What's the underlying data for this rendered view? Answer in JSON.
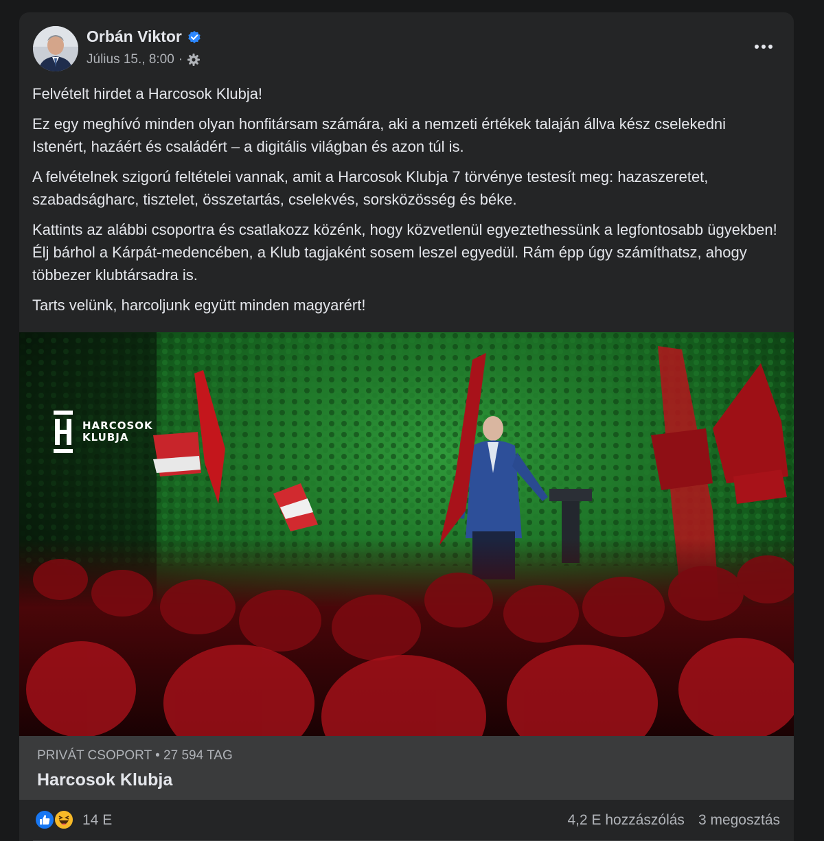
{
  "post": {
    "author": "Orbán Viktor",
    "timestamp": "Július 15., 8:00",
    "separator": "·",
    "paragraphs": [
      "Felvételt hirdet a Harcosok Klubja!",
      "Ez egy meghívó minden olyan honfitársam számára, aki a nemzeti értékek talaján állva kész cselekedni Istenért, hazáért és családért – a digitális világban és azon túl is.",
      "A felvételnek szigorú feltételei vannak, amit a Harcosok Klubja 7 törvénye testesít meg: hazaszeretet, szabadságharc, tisztelet, összetartás, cselekvés, sorsközösség és béke.",
      "Kattints az alábbi csoportra és csatlakozz közénk, hogy közvetlenül egyeztethessünk a legfontosabb ügyekben! Élj bárhol a Kárpát-medencében, a Klub tagjaként sosem leszel egyedül. Rám épp úgy számíthatsz, ahogy többezer klubtársadra is.",
      "Tarts velünk, harcoljunk együtt minden magyarért!"
    ],
    "image_logo": {
      "line1": "HARCOSOK",
      "line2": "KLUBJA"
    }
  },
  "group": {
    "meta": "PRIVÁT CSOPORT • 27 594 TAG",
    "name": "Harcosok Klubja"
  },
  "footer": {
    "reaction_count": "14 E",
    "comments": "4,2 E hozzászólás",
    "shares": "3 megosztás"
  },
  "colors": {
    "background": "#18191a",
    "card": "#242526",
    "verified": "#2d88ff",
    "like": "#1877f2",
    "haha": "#f7b928"
  },
  "icons": [
    "verified-icon",
    "gear-icon",
    "more-options-icon",
    "like-reaction-icon",
    "haha-reaction-icon"
  ]
}
